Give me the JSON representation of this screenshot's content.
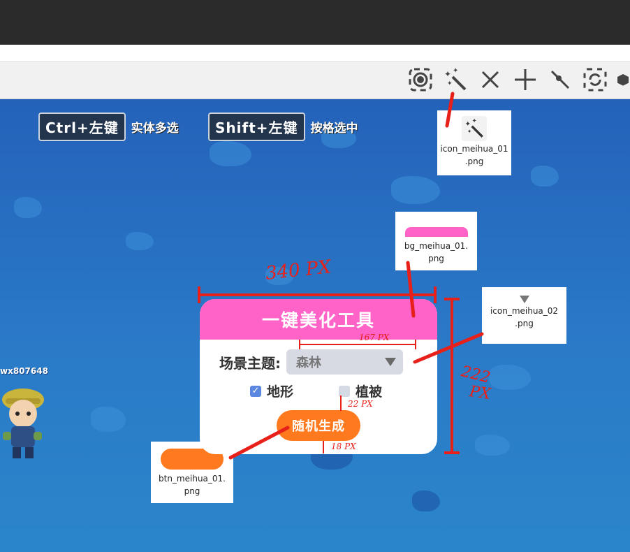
{
  "toolbar": {
    "icons": [
      "target-icon",
      "magic-wand-icon",
      "close-icon",
      "crosshair-icon",
      "pen-icon",
      "refresh-icon",
      "cube-icon"
    ]
  },
  "hints": [
    {
      "key": "Ctrl+左键",
      "text": "实体多选"
    },
    {
      "key": "Shift+左键",
      "text": "按格选中"
    }
  ],
  "player": {
    "name": "wx807648"
  },
  "panel": {
    "title": "一键美化工具",
    "theme_label": "场景主题:",
    "theme_value": "森林",
    "terrain_label": "地形",
    "terrain_checked": true,
    "vegetation_label": "植被",
    "vegetation_checked": false,
    "generate_label": "随机生成"
  },
  "annotations": {
    "icon_meihua_01": "icon_meihua_01\n.png",
    "bg_meihua_01": "bg_meihua_01.\npng",
    "icon_meihua_02": "icon_meihua_02\n.png",
    "btn_meihua_01": "btn_meihua_01.\npng",
    "width": "340 PX",
    "height_1": "222",
    "height_2": "PX",
    "select_width": "167 PX",
    "gap_22": "22 PX",
    "gap_18": "18 PX"
  },
  "colors": {
    "panel_header": "#ff63c7",
    "generate_button": "#ff7a1e",
    "annotation": "#e8201a"
  }
}
